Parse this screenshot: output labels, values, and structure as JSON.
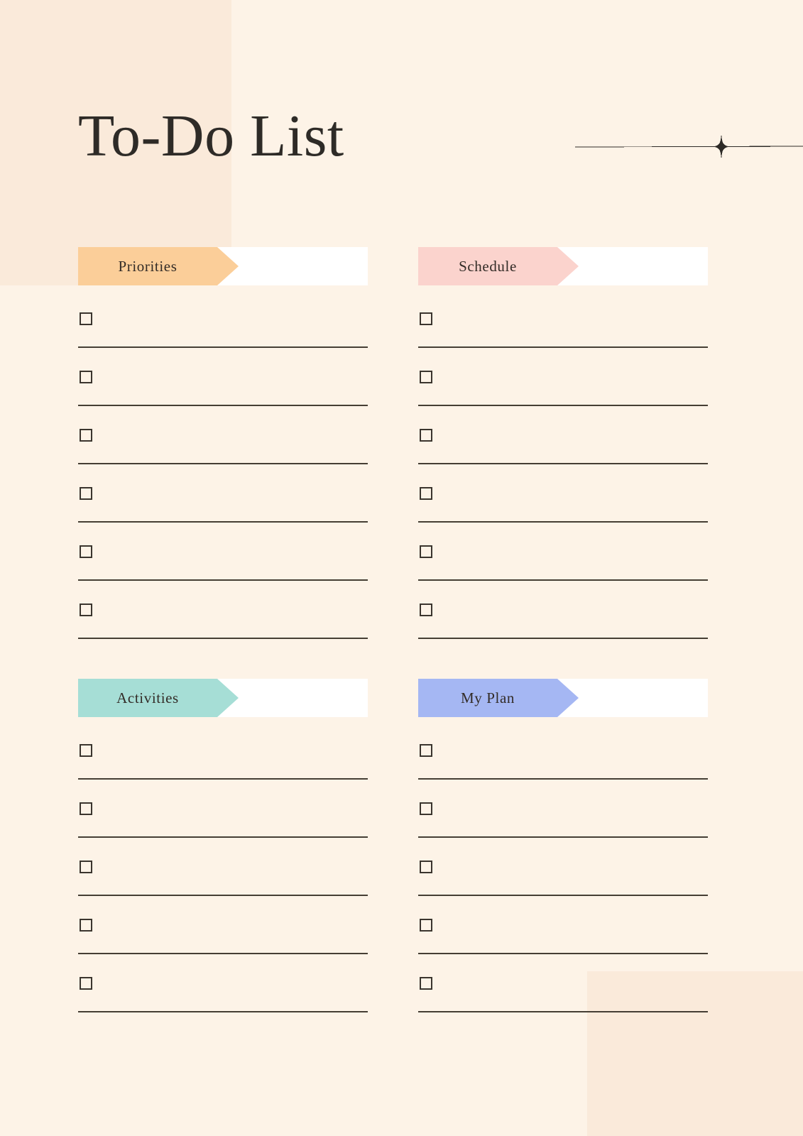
{
  "page": {
    "title": "To-Do List",
    "background_color": "#FDF3E7",
    "accent_block_color": "#FAEADA",
    "text_color": "#2E2B27",
    "line_color": "#453E34",
    "checkbox_border_color": "#3B352E",
    "header_plate_color": "#FFFFFF"
  },
  "decor": {
    "sparkle_divider": {
      "icon": "four-point-star-line-icon",
      "color": "#2E2B27"
    }
  },
  "sections": [
    {
      "id": "priorities",
      "label": "Priorities",
      "banner_color": "#FBCE99",
      "column": "left",
      "row": "top",
      "item_count": 6
    },
    {
      "id": "schedule",
      "label": "Schedule",
      "banner_color": "#FBD3CD",
      "column": "right",
      "row": "top",
      "item_count": 6
    },
    {
      "id": "activities",
      "label": "Activities",
      "banner_color": "#A6DED6",
      "column": "left",
      "row": "bottom",
      "item_count": 5
    },
    {
      "id": "my-plan",
      "label": "My Plan",
      "banner_color": "#A5B7F3",
      "column": "right",
      "row": "bottom",
      "item_count": 5
    }
  ],
  "checklist_items": {
    "priorities": [
      "",
      "",
      "",
      "",
      "",
      ""
    ],
    "schedule": [
      "",
      "",
      "",
      "",
      "",
      ""
    ],
    "activities": [
      "",
      "",
      "",
      "",
      ""
    ],
    "my-plan": [
      "",
      "",
      "",
      "",
      ""
    ]
  }
}
